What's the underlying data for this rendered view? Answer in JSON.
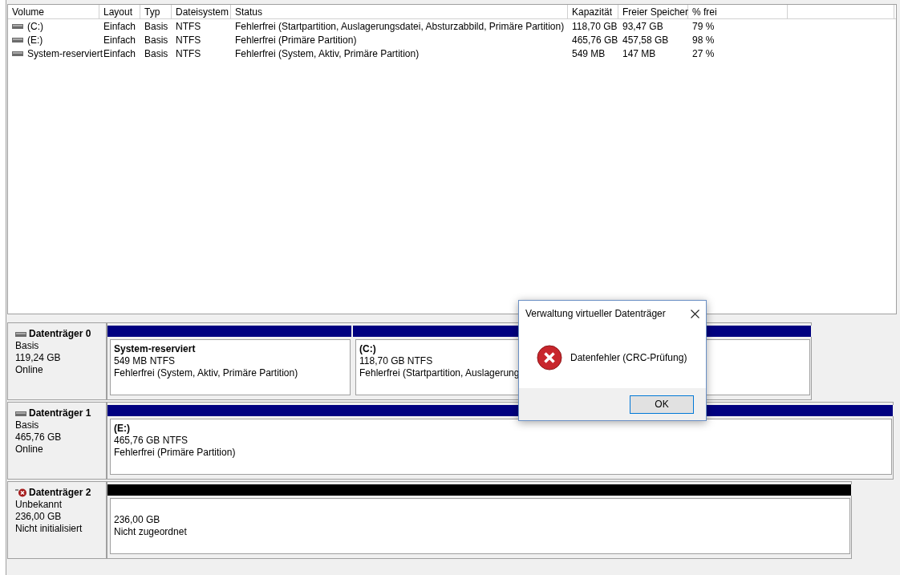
{
  "volume_list": {
    "columns": [
      "Volume",
      "Layout",
      "Typ",
      "Dateisystem",
      "Status",
      "Kapazität",
      "Freier Speicher",
      "% frei"
    ],
    "rows": [
      {
        "cells": [
          "(C:)",
          "Einfach",
          "Basis",
          "NTFS",
          "Fehlerfrei (Startpartition, Auslagerungsdatei, Absturzabbild, Primäre Partition)",
          "118,70 GB",
          "93,47 GB",
          "79 %"
        ]
      },
      {
        "cells": [
          "(E:)",
          "Einfach",
          "Basis",
          "NTFS",
          "Fehlerfrei (Primäre Partition)",
          "465,76 GB",
          "457,58 GB",
          "98 %"
        ]
      },
      {
        "cells": [
          "System-reserviert",
          "Einfach",
          "Basis",
          "NTFS",
          "Fehlerfrei (System, Aktiv, Primäre Partition)",
          "549 MB",
          "147 MB",
          "27 %"
        ]
      }
    ]
  },
  "disks": [
    {
      "kind": "ok",
      "name": "Datenträger 0",
      "lines": [
        "Basis",
        "119,24 GB",
        "Online"
      ],
      "partitions": [
        {
          "kind": "primary",
          "title": "System-reserviert",
          "lines": [
            "549 MB NTFS",
            "Fehlerfrei (System, Aktiv, Primäre Partition)"
          ]
        },
        {
          "kind": "primary",
          "title": "(C:)",
          "lines": [
            "118,70 GB NTFS",
            "Fehlerfrei (Startpartition, Auslagerung"
          ]
        }
      ]
    },
    {
      "kind": "ok",
      "name": "Datenträger 1",
      "lines": [
        "Basis",
        "465,76 GB",
        "Online"
      ],
      "partitions": [
        {
          "kind": "primary",
          "title": "(E:)",
          "lines": [
            "465,76 GB NTFS",
            "Fehlerfrei (Primäre Partition)"
          ]
        }
      ]
    },
    {
      "kind": "error",
      "name": "Datenträger 2",
      "lines": [
        "Unbekannt",
        "236,00 GB",
        "Nicht initialisiert"
      ],
      "partitions": [
        {
          "kind": "unallocated",
          "lines": [
            "236,00 GB",
            "Nicht zugeordnet"
          ]
        }
      ]
    }
  ],
  "dialog": {
    "title": "Verwaltung virtueller Datenträger",
    "message": "Datenfehler (CRC-Prüfung)",
    "buttons": [
      "OK"
    ]
  }
}
